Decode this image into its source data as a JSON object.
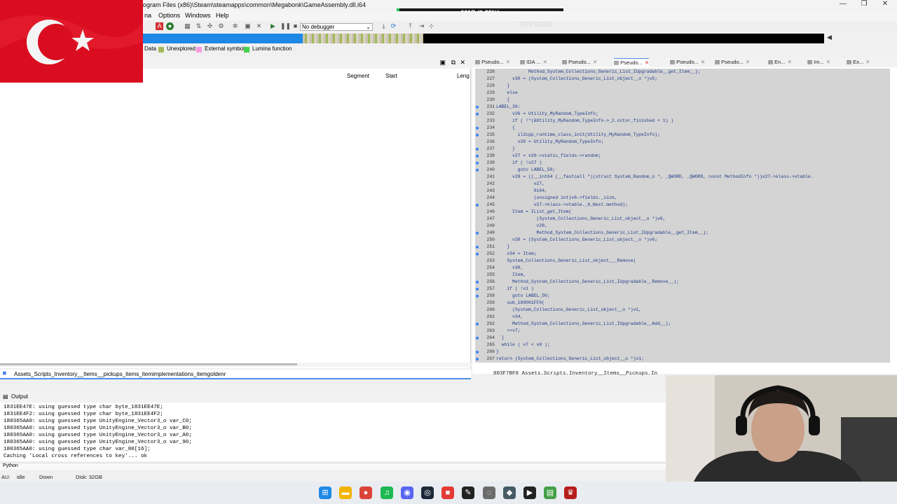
{
  "window": {
    "path_title": "ogram Files (x86)\\Steam\\steamapps\\common\\Megabonk\\GameAssembly.dll.i64",
    "memory_indicator": "661B (1.89%)",
    "memory_fraction": 0.0189,
    "watermark": "TRYS3000"
  },
  "menu": [
    "na",
    "Options",
    "Windows",
    "Help"
  ],
  "toolbar": {
    "debugger_select": "No debugger"
  },
  "legend": [
    {
      "label": "Data",
      "color": "#c9c1b0"
    },
    {
      "label": "Unexplored",
      "color": "#a3b85a"
    },
    {
      "label": "External symbol",
      "color": "#f79be0"
    },
    {
      "label": "Lumina function",
      "color": "#46d14a"
    }
  ],
  "functions_pane": {
    "columns": [
      "Segment",
      "Start",
      "Leng"
    ]
  },
  "left_status": "Assets_Scripts_Inventory__Items__pickups_items_itemimplementations_itemgoldenr",
  "tabs": [
    {
      "label": "Pseudo...",
      "active": false
    },
    {
      "label": "IDA ...",
      "active": false
    },
    {
      "label": "Pseudo...",
      "active": false
    },
    {
      "label": "Pseudo...",
      "active": true
    },
    {
      "label": "Pseudo...",
      "active": false
    },
    {
      "label": "Pseudo...",
      "active": false
    },
    {
      "label": "En...",
      "active": false
    },
    {
      "label": "Im...",
      "active": false
    },
    {
      "label": "Ex...",
      "active": false
    }
  ],
  "code_lines": [
    {
      "n": "226",
      "dot": false,
      "text": "            Method_System_Collections_Generic_List_IUpgradable__get_Item__);"
    },
    {
      "n": "227",
      "dot": false,
      "text": "      v30 = (System_Collections_Generic_List_object__o *)v5;"
    },
    {
      "n": "228",
      "dot": false,
      "text": "    }"
    },
    {
      "n": "229",
      "dot": false,
      "text": "    else"
    },
    {
      "n": "230",
      "dot": false,
      "text": "    {"
    },
    {
      "n": "231",
      "dot": true,
      "text": "LABEL_39:"
    },
    {
      "n": "232",
      "dot": true,
      "text": "      v26 = Utility_MyRandom_TypeInfo;"
    },
    {
      "n": "233",
      "dot": false,
      "text": "      if ( !*(&Utility_MyRandom_TypeInfo->_2.cctor_finished + 1) )"
    },
    {
      "n": "234",
      "dot": true,
      "text": "      {"
    },
    {
      "n": "235",
      "dot": true,
      "text": "        il2cpp_runtime_class_init(Utility_MyRandom_TypeInfo);"
    },
    {
      "n": "236",
      "dot": false,
      "text": "        v26 = Utility_MyRandom_TypeInfo;"
    },
    {
      "n": "237",
      "dot": true,
      "text": "      }"
    },
    {
      "n": "238",
      "dot": true,
      "text": "      v27 = v26->static_fields->random;"
    },
    {
      "n": "239",
      "dot": true,
      "text": "      if ( !v27 )"
    },
    {
      "n": "240",
      "dot": true,
      "text": "        goto LABEL_50;"
    },
    {
      "n": "241",
      "dot": false,
      "text": "      v28 = ((__int64 (__fastcall *)(struct System_Random_o *, _QWORD, _QWORD, const MethodInfo *))v27->klass->vtable."
    },
    {
      "n": "242",
      "dot": false,
      "text": "              v27,"
    },
    {
      "n": "243",
      "dot": false,
      "text": "              0i64,"
    },
    {
      "n": "244",
      "dot": false,
      "text": "              (unsigned int)v6->fields._size,"
    },
    {
      "n": "245",
      "dot": true,
      "text": "              v27->klass->vtable._6_Next.method);"
    },
    {
      "n": "246",
      "dot": false,
      "text": "      Item = IList_get_Item("
    },
    {
      "n": "247",
      "dot": false,
      "text": "               (System_Collections_Generic_List_object__o *)v6,"
    },
    {
      "n": "248",
      "dot": false,
      "text": "               v28,"
    },
    {
      "n": "249",
      "dot": true,
      "text": "               Method_System_Collections_Generic_List_IUpgradable__get_Item__);"
    },
    {
      "n": "250",
      "dot": false,
      "text": "      v30 = (System_Collections_Generic_List_object__o *)v6;"
    },
    {
      "n": "251",
      "dot": true,
      "text": "    }"
    },
    {
      "n": "252",
      "dot": true,
      "text": "    v34 = Item;"
    },
    {
      "n": "253",
      "dot": false,
      "text": "    System_Collections_Generic_List_object___Remove("
    },
    {
      "n": "254",
      "dot": false,
      "text": "      v30,"
    },
    {
      "n": "255",
      "dot": false,
      "text": "      Item,"
    },
    {
      "n": "256",
      "dot": true,
      "text": "      Method_System_Collections_Generic_List_IUpgradable__Remove__);"
    },
    {
      "n": "257",
      "dot": true,
      "text": "    if ( !v1 )"
    },
    {
      "n": "258",
      "dot": true,
      "text": "      goto LABEL_50;"
    },
    {
      "n": "259",
      "dot": false,
      "text": "    sub_180001FF0("
    },
    {
      "n": "260",
      "dot": false,
      "text": "      (System_Collections_Generic_List_object__o *)v1,"
    },
    {
      "n": "261",
      "dot": false,
      "text": "      v34,"
    },
    {
      "n": "262",
      "dot": true,
      "text": "      Method_System_Collections_Generic_List_IUpgradable__Add__);"
    },
    {
      "n": "263",
      "dot": false,
      "text": "    ++v7;"
    },
    {
      "n": "264",
      "dot": true,
      "text": "  }"
    },
    {
      "n": "265",
      "dot": false,
      "text": "  while ( v7 < v8 );"
    },
    {
      "n": "266",
      "dot": true,
      "text": "}"
    },
    {
      "n": "267",
      "dot": true,
      "text": "return (System_Collections_Generic_List_object__o *)v1;"
    },
    {
      "n": "",
      "dot": false,
      "text": "}"
    }
  ],
  "code_status": "003F7BF0 Assets.Scripts.Inventory__Items__Pickups.In",
  "output": {
    "title": "Output",
    "lines": [
      "1831EE47E: using guessed type char byte_1831EE47E;",
      "1831EE4F2: using guessed type char byte_1831EE4F2;",
      "180365AA0: using guessed type UnityEngine_Vector3_o var_C0;",
      "180365AA0: using guessed type UnityEngine_Vector3_o var_B0;",
      "180365AA0: using guessed type UnityEngine_Vector3_o var_A0;",
      "180365AA0: using guessed type UnityEngine_Vector3_o var_90;",
      "180365AA0: using guessed type char var_80[16];",
      "Caching 'Local cross references to key'... ok"
    ],
    "interpreter": "Python"
  },
  "status": {
    "au": "AU:",
    "state": "idle",
    "dir": "Down",
    "disk": "Disk: 32GB"
  },
  "taskbar_apps": [
    {
      "name": "windows-start-icon",
      "glyph": "⊞",
      "color": "#1e88e5"
    },
    {
      "name": "file-explorer-icon",
      "glyph": "▬",
      "color": "#f4b400"
    },
    {
      "name": "chrome-icon",
      "glyph": "●",
      "color": "#db4437"
    },
    {
      "name": "spotify-icon",
      "glyph": "♫",
      "color": "#1db954"
    },
    {
      "name": "discord-icon",
      "glyph": "◉",
      "color": "#5865f2"
    },
    {
      "name": "steam-icon",
      "glyph": "◎",
      "color": "#1b2838"
    },
    {
      "name": "record-app-icon",
      "glyph": "■",
      "color": "#e53935"
    },
    {
      "name": "pen-app-icon",
      "glyph": "✎",
      "color": "#222222"
    },
    {
      "name": "obs-icon",
      "glyph": "◌",
      "color": "#6b6b6b"
    },
    {
      "name": "ida-icon",
      "glyph": "◆",
      "color": "#455a64"
    },
    {
      "name": "terminal-icon",
      "glyph": "▶",
      "color": "#222222"
    },
    {
      "name": "notepad-icon",
      "glyph": "▤",
      "color": "#43a047"
    },
    {
      "name": "game-icon",
      "glyph": "♛",
      "color": "#b71c1c"
    }
  ]
}
